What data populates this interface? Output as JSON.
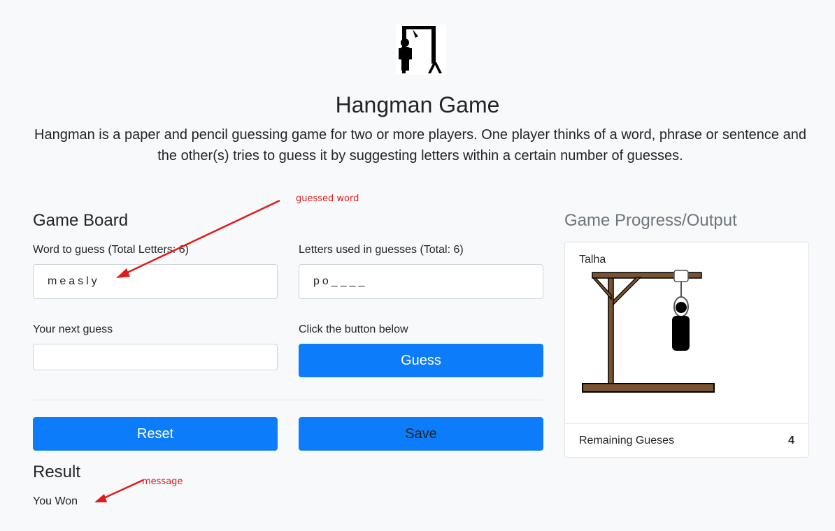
{
  "header": {
    "title": "Hangman Game",
    "description": "Hangman is a paper and pencil guessing game for two or more players. One player thinks of a word, phrase or sentence and the other(s) tries to guess it by suggesting letters within a certain number of guesses."
  },
  "board": {
    "heading": "Game Board",
    "word_label": "Word to guess (Total Letters: 6)",
    "word_value": "measly",
    "letters_label": "Letters used in guesses (Total: 6)",
    "letters_value": "po____",
    "next_guess_label": "Your next guess",
    "next_guess_value": "",
    "click_label": "Click the button below",
    "guess_button": "Guess",
    "reset_button": "Reset",
    "save_button": "Save"
  },
  "result": {
    "heading": "Result",
    "message": "You Won"
  },
  "progress": {
    "heading": "Game Progress/Output",
    "player_name": "Talha",
    "remaining_label": "Remaining Gueses",
    "remaining_value": "4"
  },
  "annotations": {
    "guessed_word": "guessed word",
    "message": "message"
  },
  "colors": {
    "primary": "#0d7cfb",
    "annotation": "#e01b1b",
    "gallows_wood": "#7a5230"
  },
  "icons": [
    "hangman-logo-icon",
    "gallows-illustration"
  ]
}
